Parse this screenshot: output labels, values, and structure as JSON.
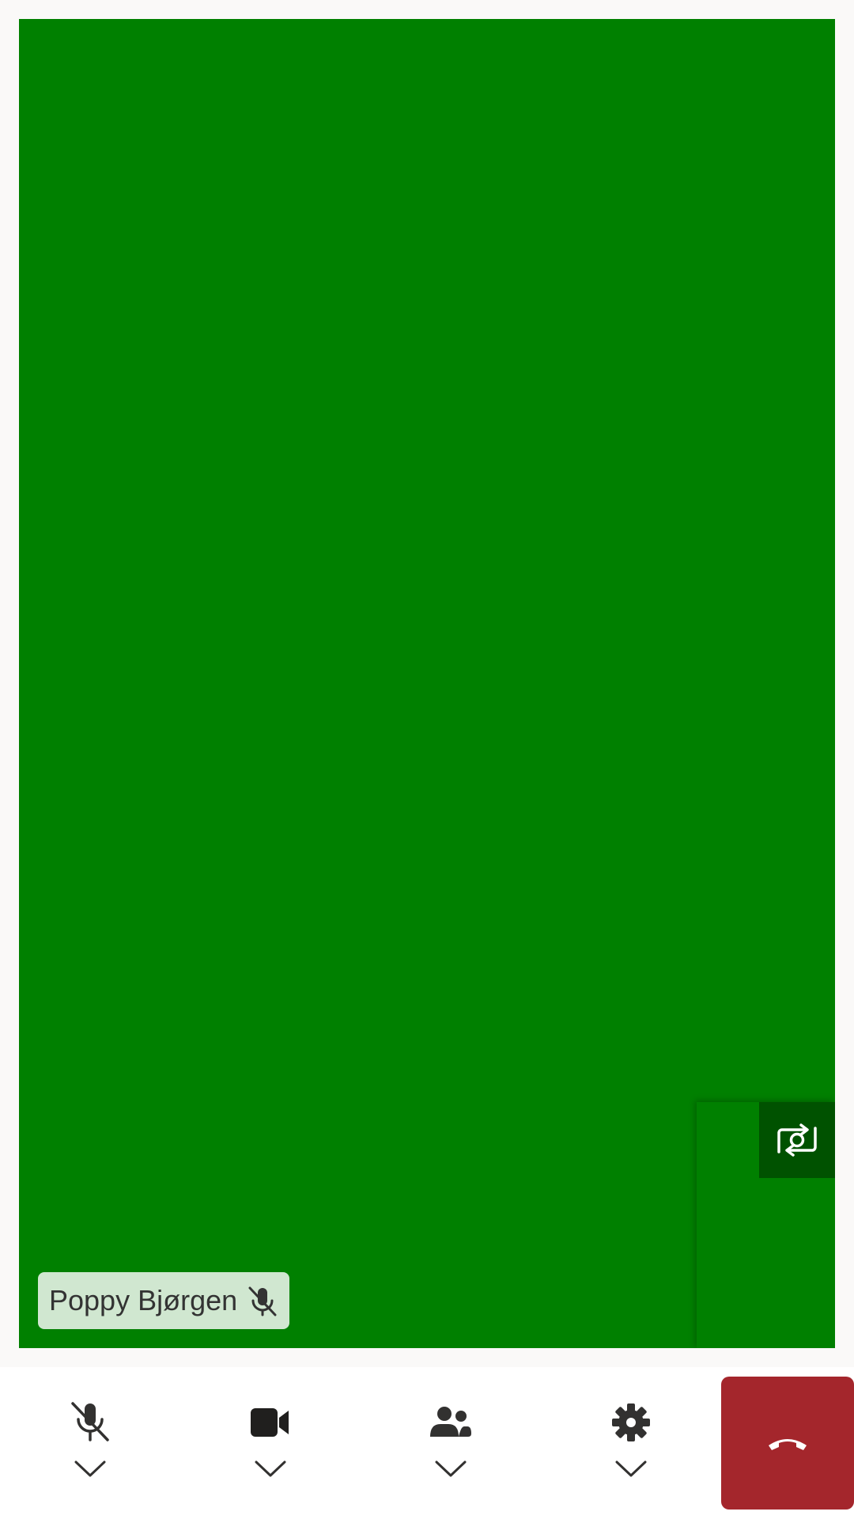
{
  "video": {
    "background_color": "#008000",
    "participant_name": "Poppy Bjørgen",
    "participant_muted_icon": "mic-off-icon",
    "flip_camera_icon": "camera-switch-icon"
  },
  "toolbar": {
    "buttons": [
      {
        "name": "microphone",
        "icon": "mic-off-icon",
        "has_options": true
      },
      {
        "name": "camera",
        "icon": "video-camera-icon",
        "has_options": true
      },
      {
        "name": "participants",
        "icon": "people-icon",
        "has_options": true
      },
      {
        "name": "settings",
        "icon": "gear-icon",
        "has_options": true
      }
    ],
    "hangup": {
      "icon": "phone-hangup-icon",
      "color": "#a4262c"
    }
  },
  "colors": {
    "stage": "#008000",
    "pip_button": "#005200",
    "name_tag_bg": "#d0e7d0",
    "hangup": "#a4262c",
    "toolbar_bg": "#ffffff",
    "page_bg": "#faf9f8"
  }
}
